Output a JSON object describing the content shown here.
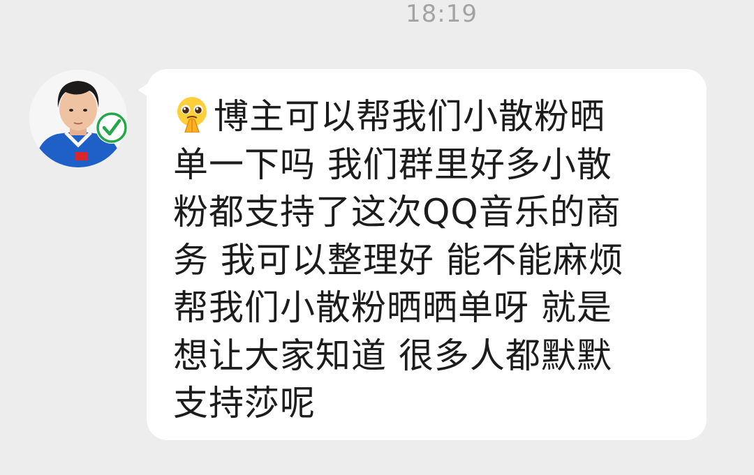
{
  "chat": {
    "timestamp": "18:19",
    "message": {
      "sender_avatar": "avatar-photo",
      "verified_badge_icon": "verified-check-icon",
      "emoji": "pleading-face-praying-hands-emoji",
      "lines": [
        "博主可以帮我们小散粉晒",
        "单一下吗 我们群里好多小散",
        "粉都支持了这次QQ音乐的商",
        "务 我可以整理好 能不能麻烦",
        "帮我们小散粉晒晒单呀 就是",
        "想让大家知道 很多人都默默",
        "支持莎呢"
      ]
    }
  },
  "colors": {
    "background": "#ededed",
    "bubble": "#ffffff",
    "text": "#1c1c1c",
    "timestamp": "#a3a3a3",
    "verified_green": "#22a84a"
  }
}
